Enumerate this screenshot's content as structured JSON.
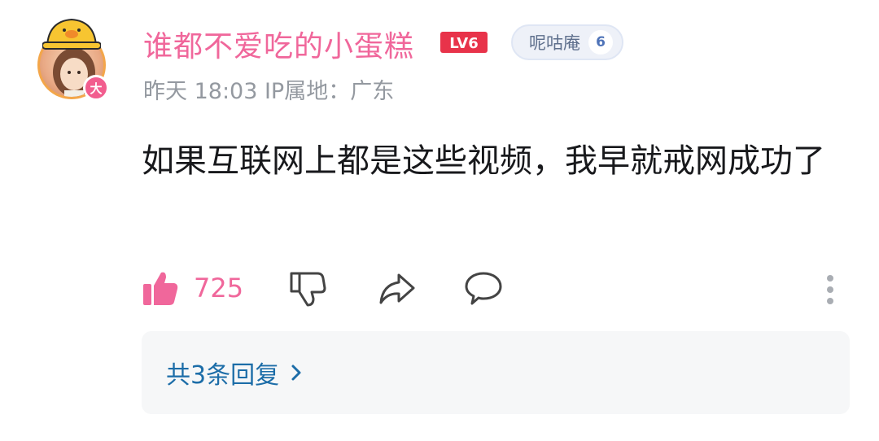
{
  "comment": {
    "user": {
      "name": "谁都不爱吃的小蛋糕",
      "level_badge": "LV6",
      "vip_badge": "大",
      "fan_medal": {
        "name": "呢咕庵",
        "level": "6"
      }
    },
    "meta": "昨天 18:03 IP属地：广东",
    "text": "如果互联网上都是这些视频，我早就戒网成功了",
    "like_count": "725",
    "reply_link": "共3条回复"
  },
  "colors": {
    "username": "#f0679b",
    "level_badge": "#e8334a",
    "like_active": "#f0679b",
    "reply_link": "#1c6da8",
    "meta": "#9499a0"
  },
  "icons": {
    "like": "thumbs-up-filled-icon",
    "dislike": "thumbs-down-outline-icon",
    "share": "share-arrow-icon",
    "reply": "speech-bubble-icon",
    "more": "vertical-dots-icon",
    "reply_chevron": "chevron-right-icon"
  }
}
